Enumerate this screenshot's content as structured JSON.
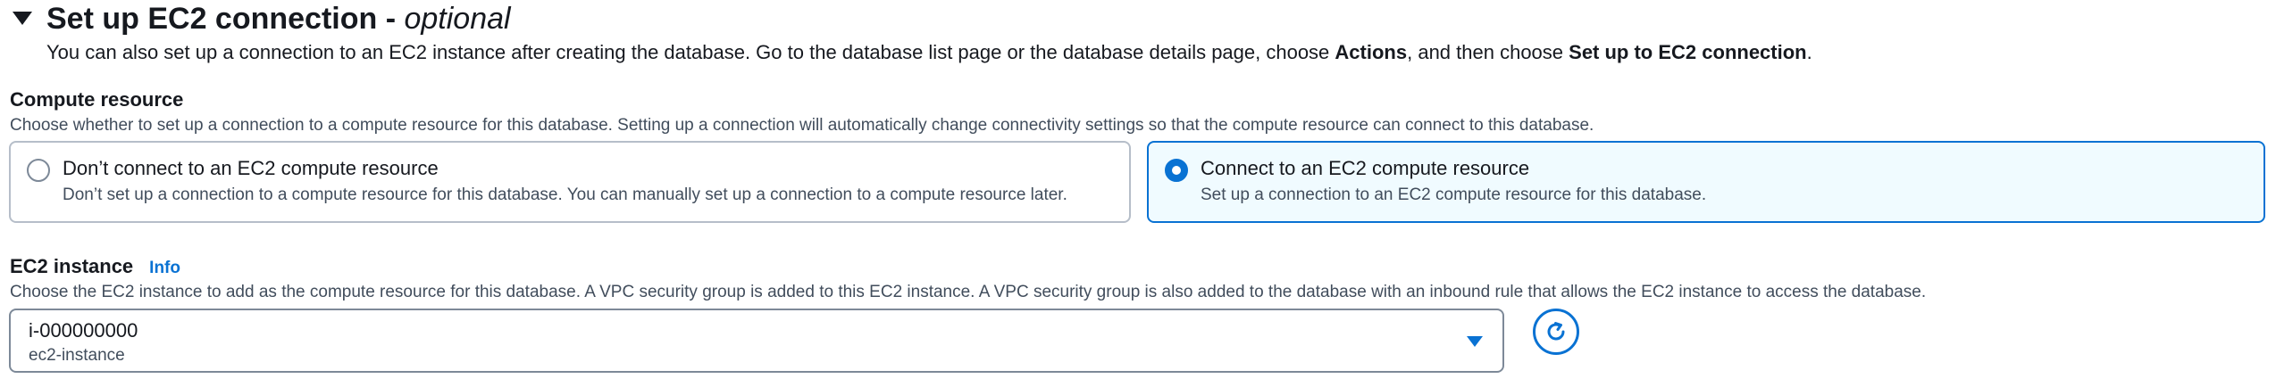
{
  "section": {
    "title": "Set up EC2 connection - ",
    "title_italic": "optional",
    "description": {
      "prefix": "You can also set up a connection to an EC2 instance after creating the database. Go to the database list page or the database details page, choose ",
      "bold1": "Actions",
      "middle": ", and then choose ",
      "bold2": "Set up to EC2 connection",
      "suffix": "."
    }
  },
  "compute_resource": {
    "label": "Compute resource",
    "description": "Choose whether to set up a connection to a compute resource for this database. Setting up a connection will automatically change connectivity settings so that the compute resource can connect to this database.",
    "options": [
      {
        "label": "Don’t connect to an EC2 compute resource",
        "description": "Don’t set up a connection to a compute resource for this database. You can manually set up a connection to a compute resource later.",
        "selected": false
      },
      {
        "label": "Connect to an EC2 compute resource",
        "description": "Set up a connection to an EC2 compute resource for this database.",
        "selected": true
      }
    ]
  },
  "ec2_instance": {
    "label": "EC2 instance",
    "info_link": "Info",
    "description": "Choose the EC2 instance to add as the compute resource for this database. A VPC security group is added to this EC2 instance. A VPC security group is also added to the database with an inbound rule that allows the EC2 instance to access the database.",
    "selected_value": "i-000000000",
    "selected_subtext": "ec2-instance",
    "icons": {
      "dropdown": "caret-down-icon",
      "refresh": "refresh-icon"
    }
  },
  "colors": {
    "accent": "#0972d3",
    "text": "#16191f",
    "muted": "#414d5c",
    "border": "#7d8998",
    "selected_bg": "#f0fbff"
  }
}
